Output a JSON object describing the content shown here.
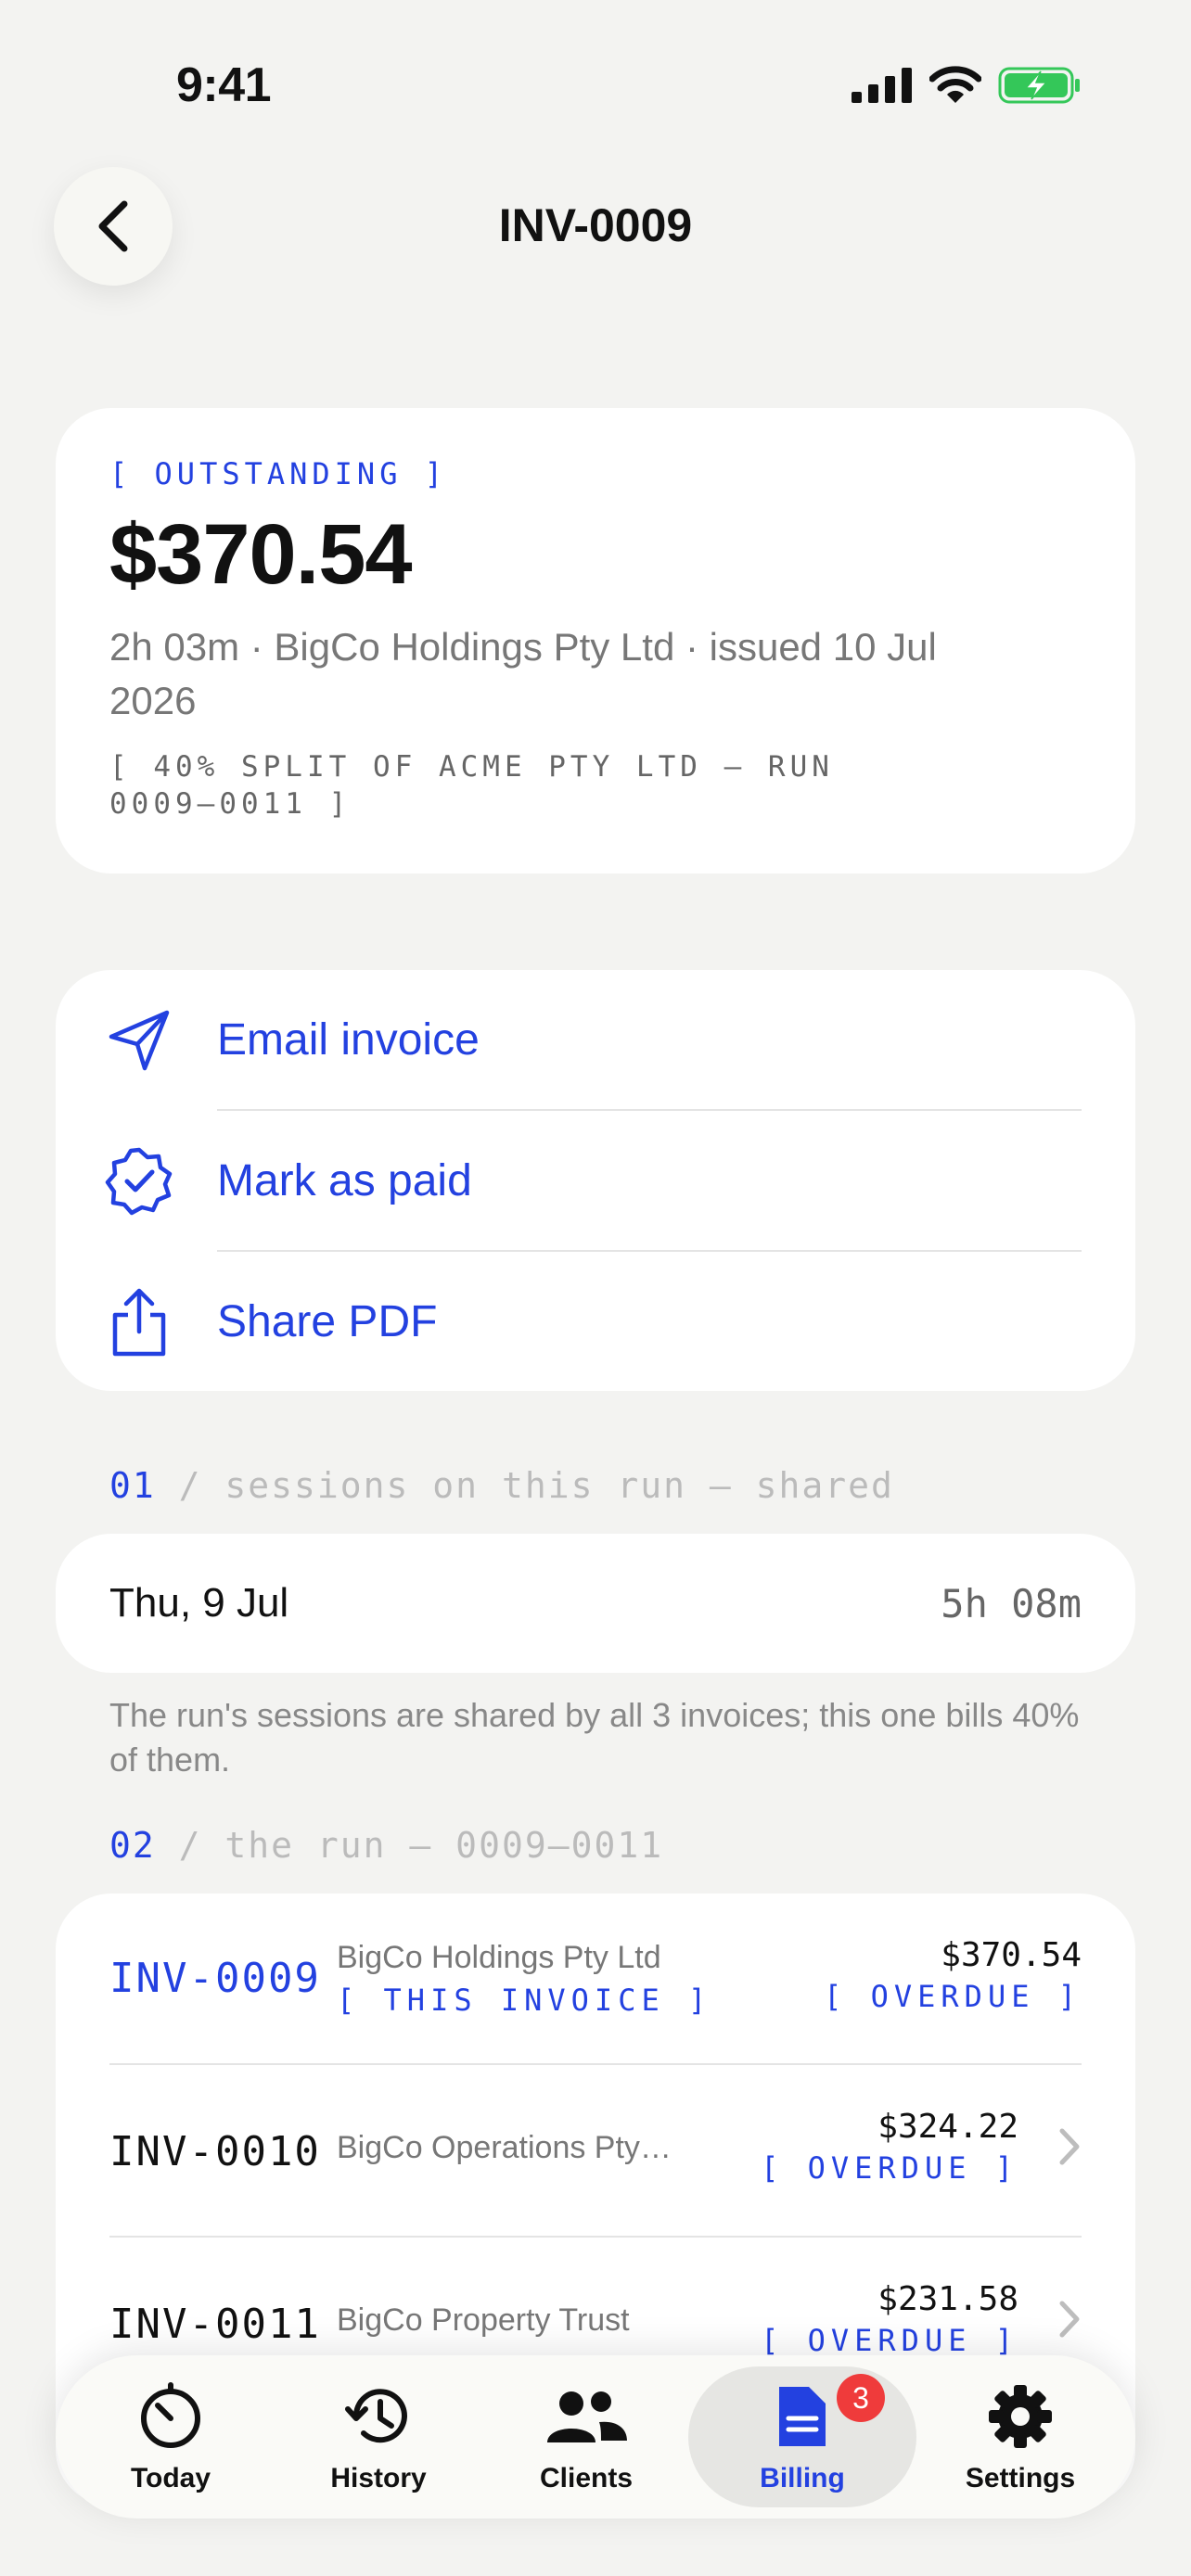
{
  "status_bar": {
    "time": "9:41"
  },
  "nav": {
    "title": "INV-0009"
  },
  "summary": {
    "status_tag": "[ OUTSTANDING ]",
    "amount": "$370.54",
    "meta": "2h 03m · BigCo Holdings Pty Ltd · issued 10 Jul 2026",
    "split_note": "[ 40% SPLIT OF ACME PTY LTD — RUN 0009–0011 ]"
  },
  "actions": [
    {
      "label": "Email invoice",
      "icon": "send-icon"
    },
    {
      "label": "Mark as paid",
      "icon": "verified-badge-icon"
    },
    {
      "label": "Share PDF",
      "icon": "share-icon"
    }
  ],
  "sections": {
    "sessions": {
      "num": "01",
      "sep": " / ",
      "title": "sessions on this run — shared"
    },
    "run": {
      "num": "02",
      "sep": " / ",
      "title": "the run — 0009–0011"
    }
  },
  "session": {
    "date": "Thu, 9 Jul",
    "duration": "5h 08m"
  },
  "session_note": "The run's sessions are shared by all 3 invoices; this one bills 40% of them.",
  "run_invoices": [
    {
      "id": "INV-0009",
      "client": "BigCo Holdings Pty Ltd",
      "sub": "[ THIS INVOICE ]",
      "amount": "$370.54",
      "status": "[ OVERDUE ]",
      "current": true
    },
    {
      "id": "INV-0010",
      "client": "BigCo Operations Pty…",
      "sub": "",
      "amount": "$324.22",
      "status": "[ OVERDUE ]",
      "current": false
    },
    {
      "id": "INV-0011",
      "client": "BigCo Property Trust",
      "sub": "",
      "amount": "$231.58",
      "status": "[ OVERDUE ]",
      "current": false
    }
  ],
  "tabbar": {
    "tabs": [
      {
        "label": "Today",
        "icon": "timer-icon"
      },
      {
        "label": "History",
        "icon": "history-icon"
      },
      {
        "label": "Clients",
        "icon": "people-icon"
      },
      {
        "label": "Billing",
        "icon": "document-icon",
        "badge": "3",
        "active": true
      },
      {
        "label": "Settings",
        "icon": "gear-icon"
      }
    ]
  },
  "colors": {
    "accent": "#2341e0",
    "badge": "#ef3b3b",
    "background": "#f3f3f1",
    "battery": "#34c759"
  }
}
